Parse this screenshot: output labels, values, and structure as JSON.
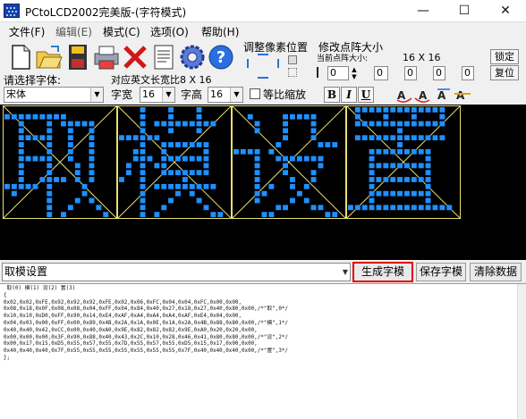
{
  "window": {
    "title": "PCtoLCD2002完美版-(字符模式)",
    "minimize": "—",
    "maximize": "☐",
    "close": "✕"
  },
  "menu": [
    {
      "label": "文件(F)"
    },
    {
      "label": "编辑(E)"
    },
    {
      "label": "模式(C)"
    },
    {
      "label": "选项(O)"
    },
    {
      "label": "帮助(H)"
    }
  ],
  "toolbar": {
    "icons": [
      "new-icon",
      "open-icon",
      "save-icon",
      "print-icon",
      "delete-icon",
      "document-icon",
      "settings-gear-icon",
      "help-icon"
    ],
    "adjust_label": "调整像素位置",
    "dot_label": "修改点阵大小",
    "current_dot_label": "当前点阵大小:",
    "current_dot_value": "16 X 16",
    "lock_label": "锁定",
    "reset_label": "复位",
    "spin_values": [
      "0",
      "0",
      "0",
      "0",
      "0",
      "0"
    ]
  },
  "font_row": {
    "select_font_label": "请选择字体:",
    "font_value": "宋体",
    "eng_width_label": "对应英文长宽比8 X 16",
    "width_label": "字宽",
    "width_value": "16",
    "height_label": "字高",
    "height_value": "16",
    "equal_ratio_label": "等比缩放",
    "bold": "B",
    "italic": "I",
    "underline": "U"
  },
  "glyph_cells": 4,
  "input": {
    "text": "取模设置",
    "generate": "生成字模",
    "save": "保存字模",
    "clear": "清除数据"
  },
  "output": {
    "header": " 取(0) 模(1) 设(2) 置(3)",
    "lines": [
      "{",
      "0x02,0x02,0xFE,0x92,0x92,0x92,0xFE,0x02,0x06,0xFC,0x04,0x04,0xFC,0x00,0x00,",
      "0x08,0x18,0x0F,0x08,0x08,0x04,0xFF,0x04,0x84,0x40,0x27,0x18,0x27,0x40,0x80,0x00,/*\"取\",0*/",
      "",
      "0x10,0x10,0xD0,0xFF,0x90,0x14,0xE4,0xAF,0xA4,0xA4,0xA4,0xAF,0xE4,0x04,0x00,",
      "0x04,0x03,0x00,0xFF,0x00,0x89,0x4B,0x2A,0x1A,0x0E,0x1A,0x2A,0x4B,0x88,0x80,0x00,/*\"模\",1*/",
      "",
      "0x40,0x40,0x42,0xCC,0x00,0x40,0xA0,0x9E,0x82,0x82,0x82,0x9E,0xA0,0x20,0x20,0x00,",
      "0x00,0x00,0x00,0x3F,0x90,0x88,0x40,0x43,0x2C,0x10,0x28,0x46,0x41,0x80,0x80,0x00,/*\"设\",2*/",
      "",
      "0x00,0x17,0x15,0xD5,0x55,0x57,0x55,0x7D,0x55,0x57,0x55,0xD5,0x15,0x17,0x00,0x00,",
      "0x40,0x40,0x40,0x7F,0x55,0x55,0x55,0x55,0x55,0x55,0x55,0x7F,0x40,0x40,0x40,0x00,/*\"置\",3*/",
      "",
      "};"
    ]
  },
  "colors": {
    "pixel": "#1e90ff",
    "grid": "#e8e070",
    "highlight": "#e00000",
    "canvas": "#000000"
  }
}
